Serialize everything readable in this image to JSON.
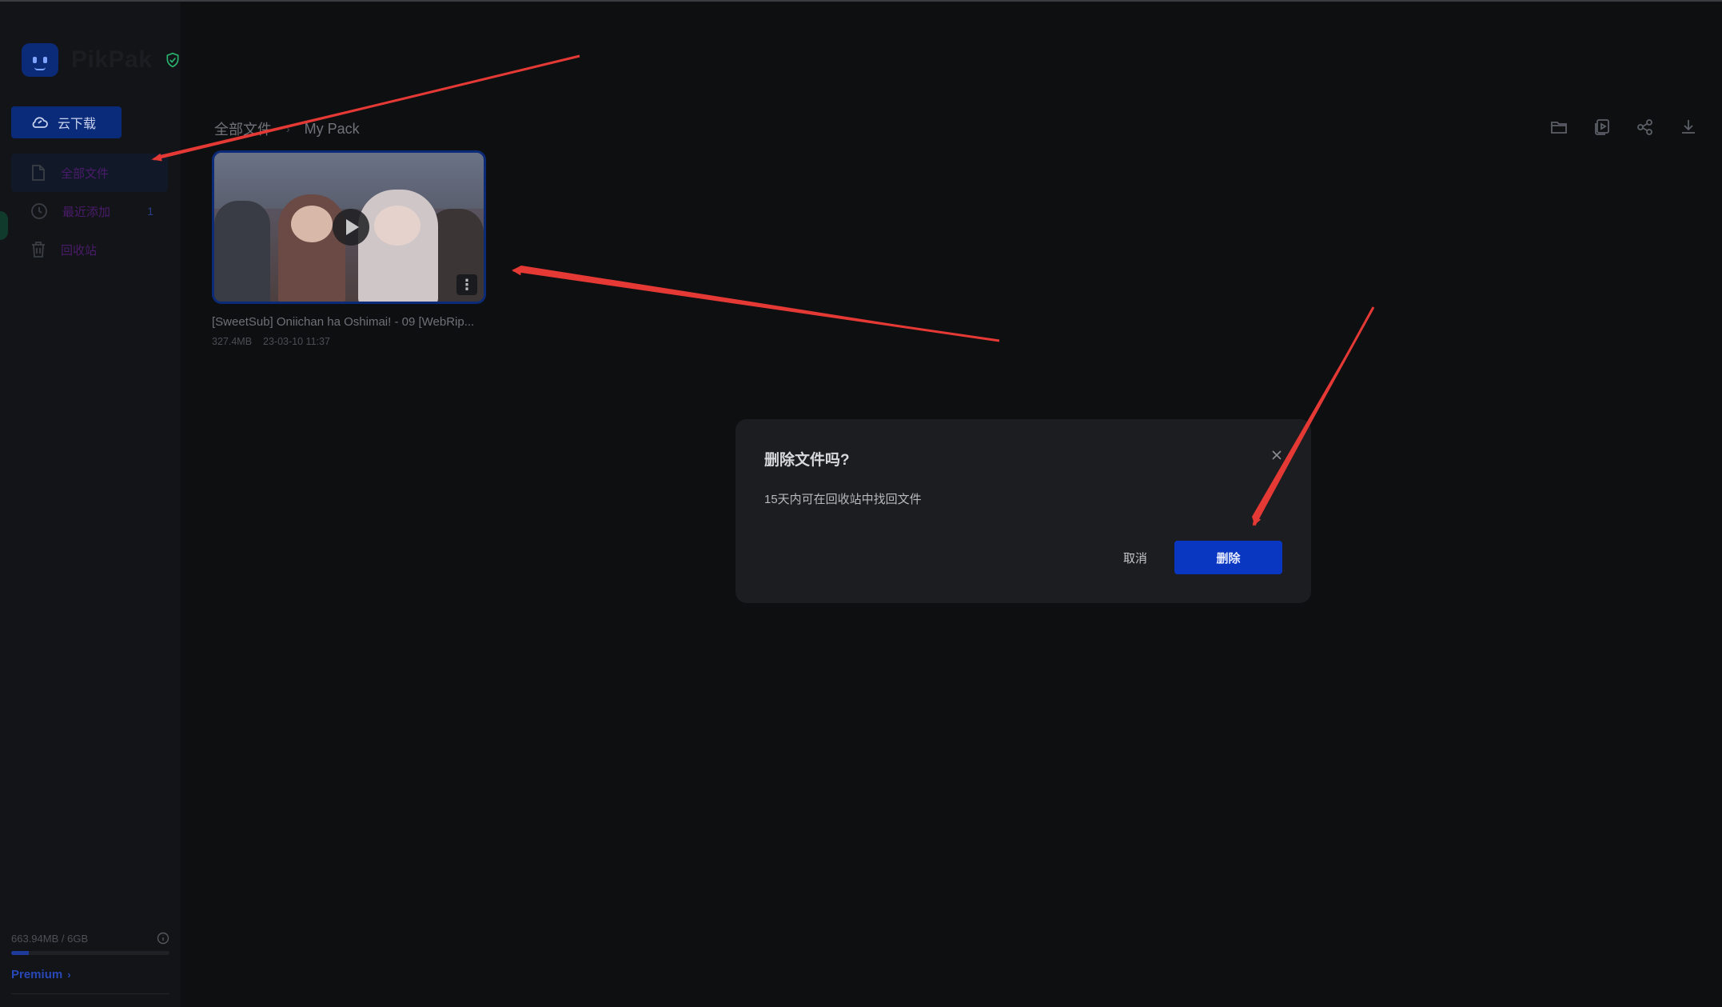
{
  "app": {
    "name": "PikPak"
  },
  "sidebar": {
    "cloud_button_label": "云下载",
    "items": [
      {
        "label": "全部文件",
        "icon": "file-icon",
        "active": true,
        "count": ""
      },
      {
        "label": "最近添加",
        "icon": "clock-icon",
        "active": false,
        "count": "1"
      },
      {
        "label": "回收站",
        "icon": "trash-icon",
        "active": false,
        "count": ""
      }
    ],
    "storage": {
      "text": "663.94MB / 6GB",
      "used_fraction": 0.11
    },
    "premium_label": "Premium"
  },
  "breadcrumb": {
    "root": "全部文件",
    "current": "My Pack"
  },
  "toolbar": {
    "icons": [
      "folder-icon",
      "media-icon",
      "share-icon",
      "download-icon"
    ]
  },
  "file": {
    "name": "[SweetSub] Oniichan ha Oshimai! - 09 [WebRip...",
    "size": "327.4MB",
    "date": "23-03-10 11:37"
  },
  "dialog": {
    "title": "删除文件吗?",
    "message": "15天内可在回收站中找回文件",
    "cancel_label": "取消",
    "confirm_label": "删除"
  },
  "colors": {
    "background": "#0e0f11",
    "accent": "#0a37c2",
    "annotation_arrow": "#e53935"
  }
}
